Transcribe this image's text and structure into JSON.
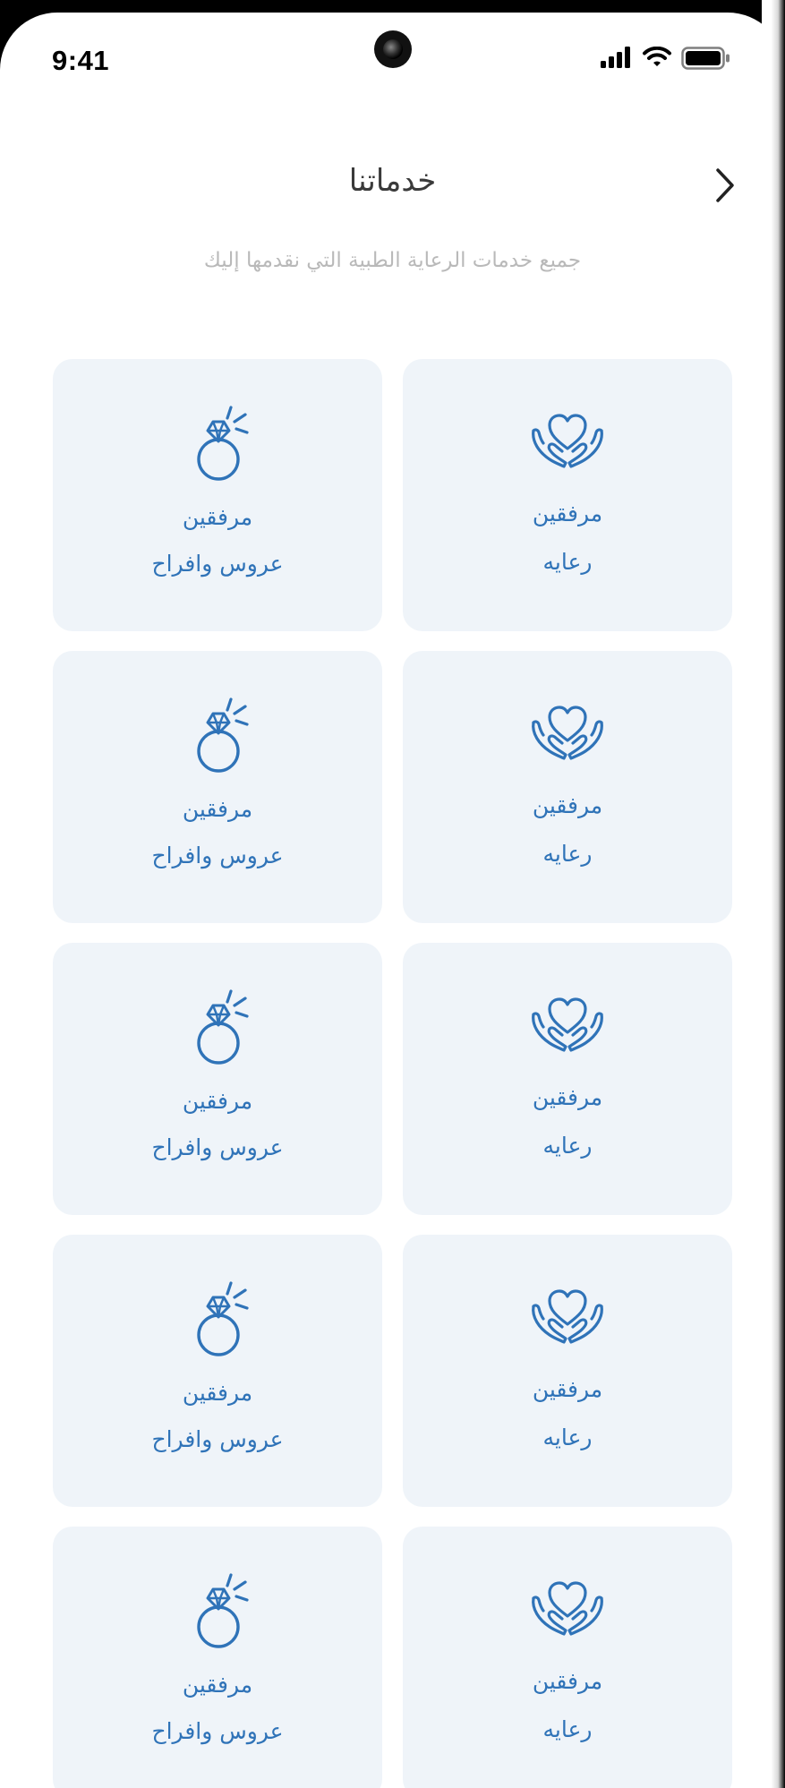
{
  "status_bar": {
    "time": "9:41"
  },
  "header": {
    "title": "خدماتنا",
    "subtitle": "جميع خدمات الرعاية الطبية التي نقدمها إليك"
  },
  "services": [
    {
      "icon": "caring-hands-heart-icon",
      "line1": "مرفقين",
      "line2": "رعايه"
    },
    {
      "icon": "diamond-ring-icon",
      "line1": "مرفقين",
      "line2": "عروس وافراح"
    },
    {
      "icon": "caring-hands-heart-icon",
      "line1": "مرفقين",
      "line2": "رعايه"
    },
    {
      "icon": "diamond-ring-icon",
      "line1": "مرفقين",
      "line2": "عروس وافراح"
    },
    {
      "icon": "caring-hands-heart-icon",
      "line1": "مرفقين",
      "line2": "رعايه"
    },
    {
      "icon": "diamond-ring-icon",
      "line1": "مرفقين",
      "line2": "عروس وافراح"
    },
    {
      "icon": "caring-hands-heart-icon",
      "line1": "مرفقين",
      "line2": "رعايه"
    },
    {
      "icon": "diamond-ring-icon",
      "line1": "مرفقين",
      "line2": "عروس وافراح"
    },
    {
      "icon": "caring-hands-heart-icon",
      "line1": "مرفقين",
      "line2": "رعايه"
    },
    {
      "icon": "diamond-ring-icon",
      "line1": "مرفقين",
      "line2": "عروس وافراح"
    }
  ],
  "colors": {
    "accent": "#2f73b8",
    "card_bg": "#eff4f9",
    "subtitle": "#b9b9b9"
  }
}
